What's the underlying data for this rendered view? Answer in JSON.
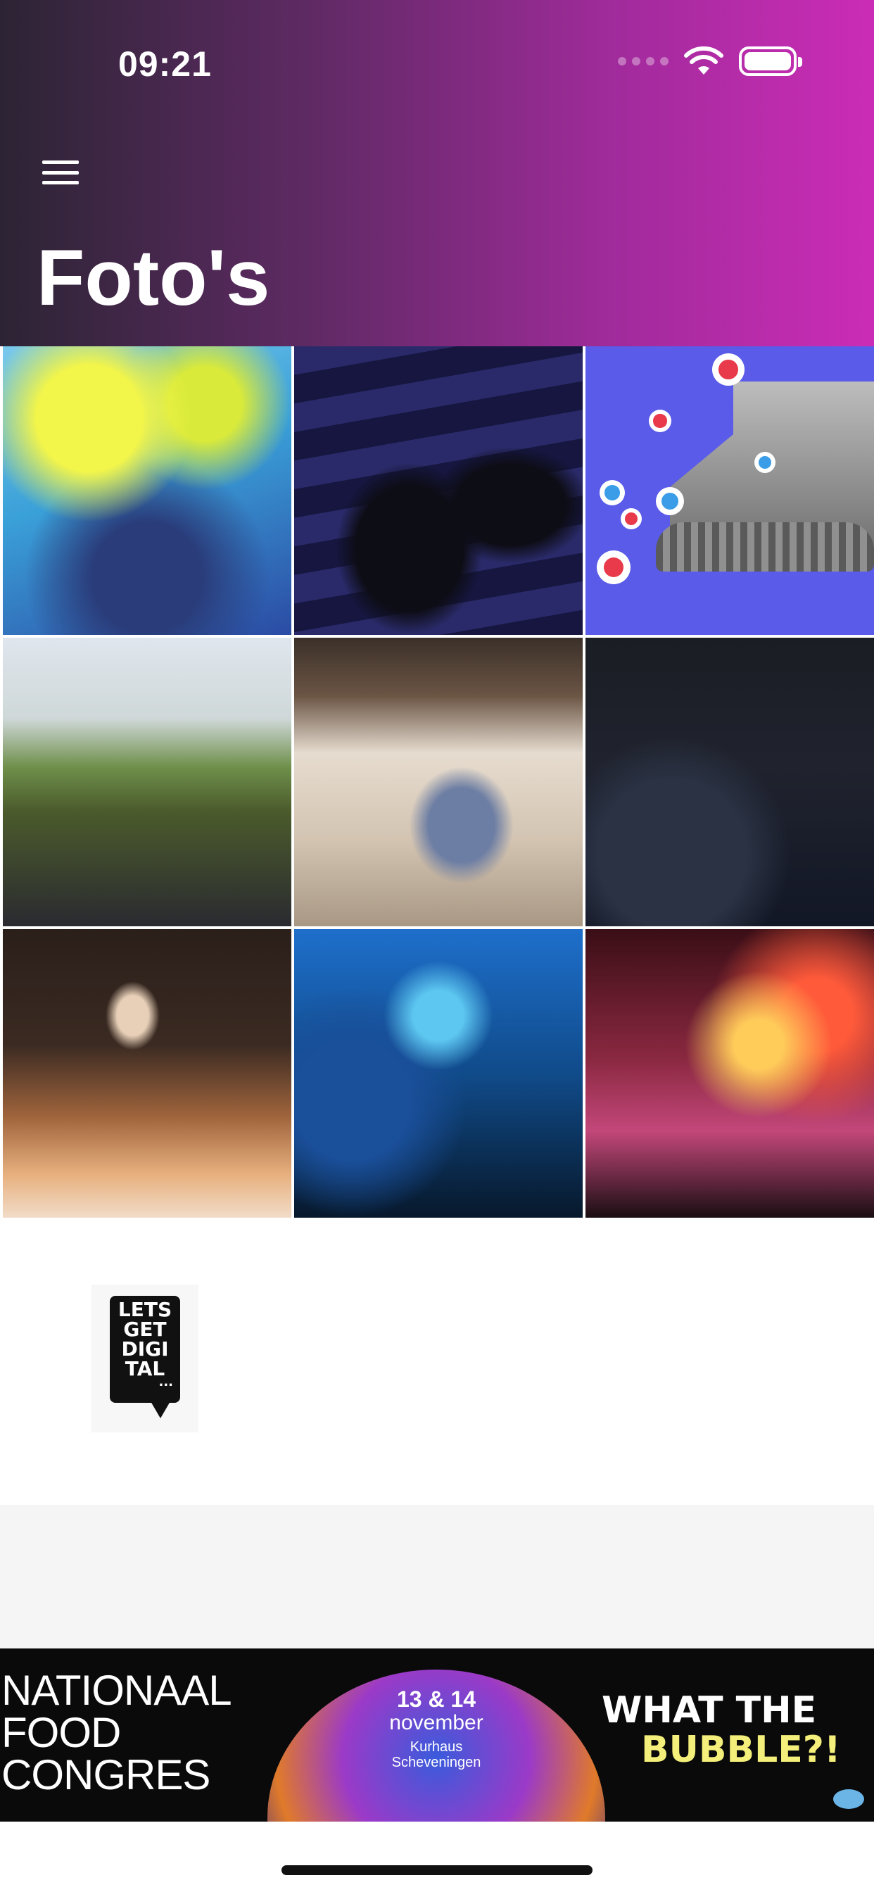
{
  "status_bar": {
    "time": "09:21"
  },
  "header": {
    "title": "Foto's"
  },
  "photos": [
    {
      "alt": "festival-color-powder"
    },
    {
      "alt": "empty-conference-chairs"
    },
    {
      "alt": "virtual-stage-reactions"
    },
    {
      "alt": "festival-crowd-friends"
    },
    {
      "alt": "speaker-audience-hall"
    },
    {
      "alt": "conference-audience-dark"
    },
    {
      "alt": "concert-crowd-hands"
    },
    {
      "alt": "stage-microphone-blue"
    },
    {
      "alt": "concert-phone-recording"
    }
  ],
  "logo": {
    "lines": [
      "LETS",
      "GET",
      "DIGI",
      "TAL"
    ],
    "dots": "..."
  },
  "banner": {
    "left_lines": [
      "NATIONAAL",
      "FOOD",
      "CONGRES"
    ],
    "date": "13 & 14",
    "month": "november",
    "venue_line1": "Kurhaus",
    "venue_line2": "Scheveningen",
    "slogan_line1": "WHAT THE",
    "slogan_line2": "BUBBLE?!"
  }
}
